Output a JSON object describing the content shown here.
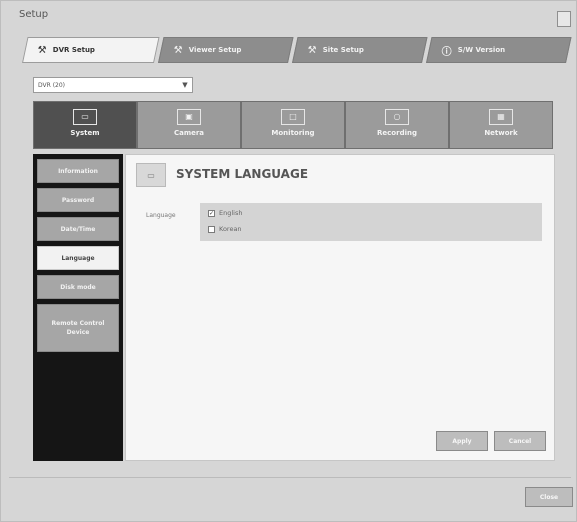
{
  "window": {
    "title": "Setup"
  },
  "model_select": {
    "value": "DVR (20)"
  },
  "top_tabs": [
    {
      "label": "DVR Setup",
      "icon": "⚒",
      "active": true
    },
    {
      "label": "Viewer Setup",
      "icon": "⚒",
      "active": false
    },
    {
      "label": "Site Setup",
      "icon": "⚒",
      "active": false
    },
    {
      "label": "S/W Version",
      "icon": "ⓘ",
      "active": false
    }
  ],
  "categories": [
    {
      "label": "System",
      "icon": "▭",
      "active": true
    },
    {
      "label": "Camera",
      "icon": "▣",
      "active": false
    },
    {
      "label": "Monitoring",
      "icon": "□",
      "active": false
    },
    {
      "label": "Recording",
      "icon": "○",
      "active": false
    },
    {
      "label": "Network",
      "icon": "▦",
      "active": false
    }
  ],
  "sidenav": [
    {
      "label": "Information",
      "active": false
    },
    {
      "label": "Password",
      "active": false
    },
    {
      "label": "Date/Time",
      "active": false
    },
    {
      "label": "Language",
      "active": true
    },
    {
      "label": "Disk mode",
      "active": false
    },
    {
      "label": "Remote Control Device",
      "active": false
    }
  ],
  "main": {
    "title": "SYSTEM LANGUAGE",
    "language_label": "Language",
    "options": [
      {
        "label": "English",
        "checked": true
      },
      {
        "label": "Korean",
        "checked": false
      }
    ]
  },
  "buttons": {
    "apply": "Apply",
    "cancel": "Cancel",
    "close": "Close"
  }
}
